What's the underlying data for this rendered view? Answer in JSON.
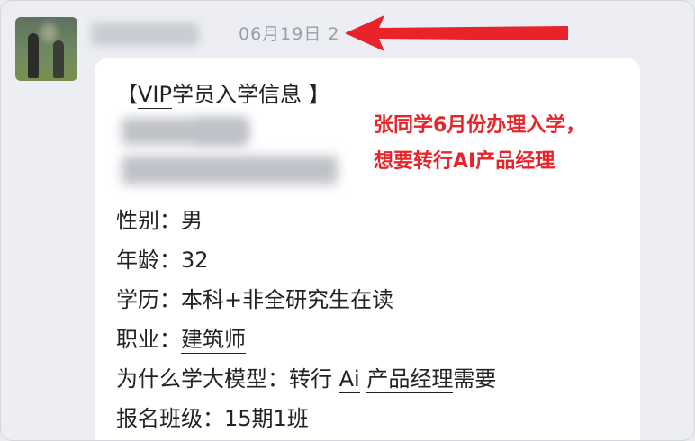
{
  "chat": {
    "timestamp": "06月19日 2"
  },
  "message": {
    "title_open": "【",
    "title_vip": "VIP",
    "title_rest": "学员入学信息 】",
    "fields": {
      "gender_label": "性别：",
      "gender_value": "男",
      "age_label": "年龄：",
      "age_value": "32",
      "education_label": "学历：",
      "education_value": "本科+非全研究生在读",
      "job_label": "职业：",
      "job_value": "建筑师",
      "reason_label": "为什么学大模型：",
      "reason_part1": "转行",
      "reason_ai": "Ai",
      "reason_product": "产品经理",
      "reason_part2": "需要",
      "class_label": "报名班级：",
      "class_value": "15期1班"
    }
  },
  "annotation": {
    "line1": "张同学6月份办理入学，",
    "line2": "想要转行AI产品经理",
    "color": "#e8232a"
  },
  "colors": {
    "background": "#e9ebf1",
    "bubble": "#ffffff",
    "text": "#222222",
    "timestamp": "#9a9ea6"
  }
}
